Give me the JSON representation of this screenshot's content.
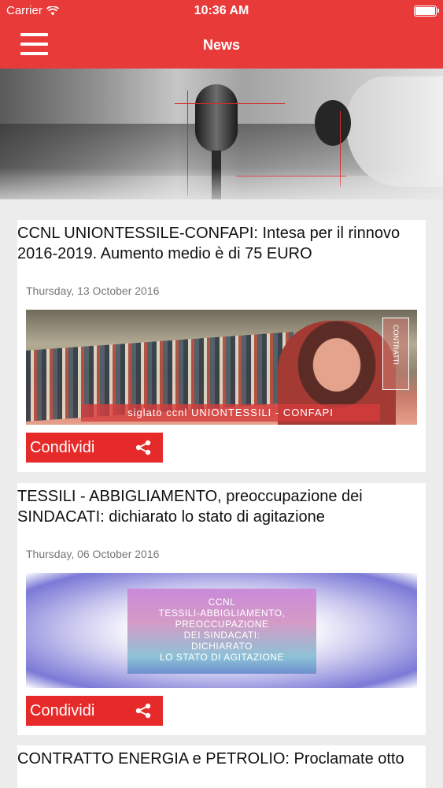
{
  "status_bar": {
    "carrier": "Carrier",
    "time": "10:36 AM"
  },
  "nav": {
    "title": "News",
    "menu_icon": "hamburger-menu-icon"
  },
  "hero": {
    "description_icon": "microphone-banner-image"
  },
  "news": [
    {
      "title": "CCNL UNIONTESSILE-CONFAPI: Intesa per il rinnovo 2016-2019. Aumento medio è di 75 EURO",
      "date": "Thursday, 13 October 2016",
      "image_caption": "siglato ccnl UNIONTESSILI - CONFAPI",
      "image_badge": "CONTRATTI",
      "share_label": "Condividi"
    },
    {
      "title": "TESSILI - ABBIGLIAMENTO, preoccupazione dei SINDACATI: dichiarato lo stato di agitazione",
      "date": "Thursday, 06 October 2016",
      "image_caption": "CCNL\nTESSILI-ABBIGLIAMENTO,\nPREOCCUPAZIONE\nDEI SINDACATI:\nDICHIARATO\nLO STATO DI AGITAZIONE",
      "share_label": "Condividi"
    },
    {
      "title": "CONTRATTO ENERGIA e PETROLIO: Proclamate otto"
    }
  ],
  "colors": {
    "accent": "#e93a3a",
    "button": "#e62a2a",
    "background": "#ececec"
  }
}
